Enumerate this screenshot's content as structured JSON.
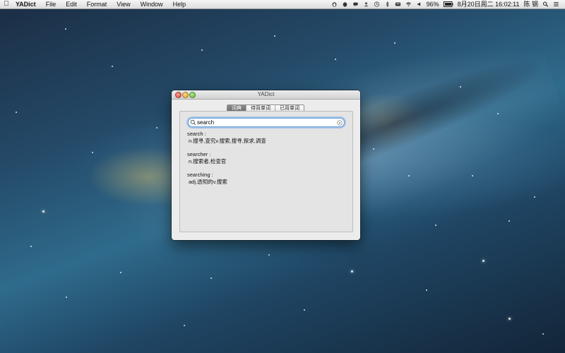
{
  "menubar": {
    "app_name": "YADict",
    "menus": [
      "File",
      "Edit",
      "Format",
      "View",
      "Window",
      "Help"
    ],
    "battery": "96%",
    "datetime": "8月20日周二  16:02:11",
    "user": "陈 钢"
  },
  "window": {
    "title": "YADict",
    "tabs": [
      {
        "label": "词典",
        "active": true
      },
      {
        "label": "待背单词",
        "active": false
      },
      {
        "label": "已背单词",
        "active": false
      }
    ],
    "search": {
      "value": "search"
    },
    "results": [
      {
        "word": "search :",
        "definition": "n.搜寻,查究v.搜索,搜寻,探求,调查"
      },
      {
        "word": "searcher :",
        "definition": "n.搜索者,检查官"
      },
      {
        "word": "searching :",
        "definition": "adj.透彻的v.搜索"
      }
    ]
  }
}
